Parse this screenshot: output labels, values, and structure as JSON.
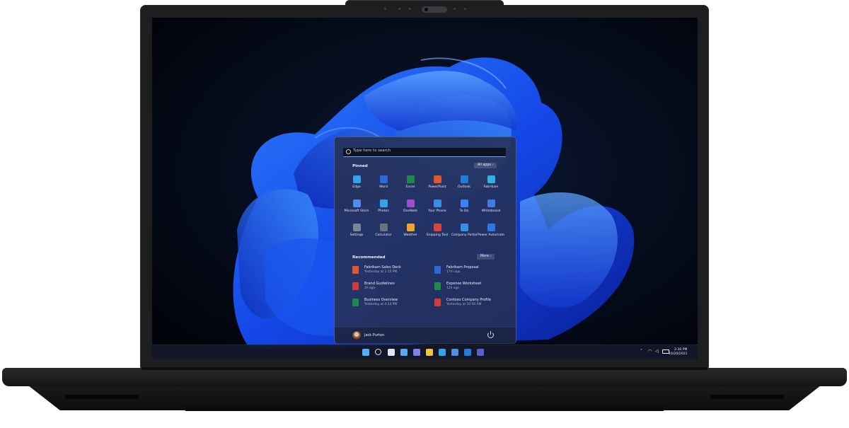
{
  "start_menu": {
    "search_placeholder": "Type here to search",
    "pinned_title": "Pinned",
    "all_apps_label": "All apps",
    "pinned": [
      {
        "label": "Edge",
        "icon": "edge-icon",
        "color": "#2fa4e9"
      },
      {
        "label": "Word",
        "icon": "word-icon",
        "color": "#2b6ad8"
      },
      {
        "label": "Excel",
        "icon": "excel-icon",
        "color": "#1d8a4c"
      },
      {
        "label": "PowerPoint",
        "icon": "powerpoint-icon",
        "color": "#e0572f"
      },
      {
        "label": "Outlook",
        "icon": "outlook-icon",
        "color": "#1f7fd6"
      },
      {
        "label": "Fabrikam",
        "icon": "fabrikam-icon",
        "color": "#2fb1e8"
      },
      {
        "label": "Microsoft Store",
        "icon": "store-icon",
        "color": "#4f8ee8"
      },
      {
        "label": "Photos",
        "icon": "photos-icon",
        "color": "#3aa0e6"
      },
      {
        "label": "OneNote",
        "icon": "onenote-icon",
        "color": "#9b4fd1"
      },
      {
        "label": "Your Phone",
        "icon": "phone-icon",
        "color": "#3a8de0"
      },
      {
        "label": "To Do",
        "icon": "todo-icon",
        "color": "#3b82f6"
      },
      {
        "label": "Whiteboard",
        "icon": "whiteboard-icon",
        "color": "#3f7be0"
      },
      {
        "label": "Settings",
        "icon": "settings-icon",
        "color": "#7c8594"
      },
      {
        "label": "Calculator",
        "icon": "calculator-icon",
        "color": "#6b7280"
      },
      {
        "label": "Weather",
        "icon": "weather-icon",
        "color": "#f0a52a"
      },
      {
        "label": "Snipping Tool",
        "icon": "snipping-icon",
        "color": "#d9453a"
      },
      {
        "label": "Company Portal",
        "icon": "company-portal-icon",
        "color": "#3a8de0"
      },
      {
        "label": "Power Automate",
        "icon": "power-automate-icon",
        "color": "#2b78e4"
      }
    ],
    "recommended_title": "Recommended",
    "more_label": "More",
    "recommended": [
      {
        "name": "Fabrikam Sales Deck",
        "time": "Yesterday at 1:15 PM",
        "icon": "powerpoint-file-icon",
        "color": "#e0572f"
      },
      {
        "name": "Fabrikam Proposal",
        "time": "17m ago",
        "icon": "word-file-icon",
        "color": "#2b6ad8"
      },
      {
        "name": "Brand Guidelines",
        "time": "2h ago",
        "icon": "pdf-file-icon",
        "color": "#d23b3b"
      },
      {
        "name": "Expense Worksheet",
        "time": "12h ago",
        "icon": "excel-file-icon",
        "color": "#1d8a4c"
      },
      {
        "name": "Business Overview",
        "time": "Yesterday at 4:24 PM",
        "icon": "excel-file-icon",
        "color": "#1d8a4c"
      },
      {
        "name": "Contoso Company Profile",
        "time": "Yesterday at 10:50 AM",
        "icon": "pdf-file-icon",
        "color": "#d23b3b"
      }
    ],
    "user_name": "Jack Purton"
  },
  "taskbar": {
    "icons": [
      {
        "icon": "windows-start-icon",
        "color": "#4fb0f5"
      },
      {
        "icon": "search-icon",
        "color": "#e6e9f4"
      },
      {
        "icon": "task-view-icon",
        "color": "#dfe3ee"
      },
      {
        "icon": "widgets-icon",
        "color": "#5aa8f0"
      },
      {
        "icon": "teams-chat-icon",
        "color": "#7b83eb"
      },
      {
        "icon": "file-explorer-icon",
        "color": "#f2c43b"
      },
      {
        "icon": "edge-icon",
        "color": "#2fa4e9"
      },
      {
        "icon": "store-icon",
        "color": "#4f8ee8"
      },
      {
        "icon": "outlook-icon",
        "color": "#1f7fd6"
      },
      {
        "icon": "teams-icon",
        "color": "#5b5fc7"
      }
    ],
    "time": "2:30 PM",
    "date": "10/20/2021"
  }
}
